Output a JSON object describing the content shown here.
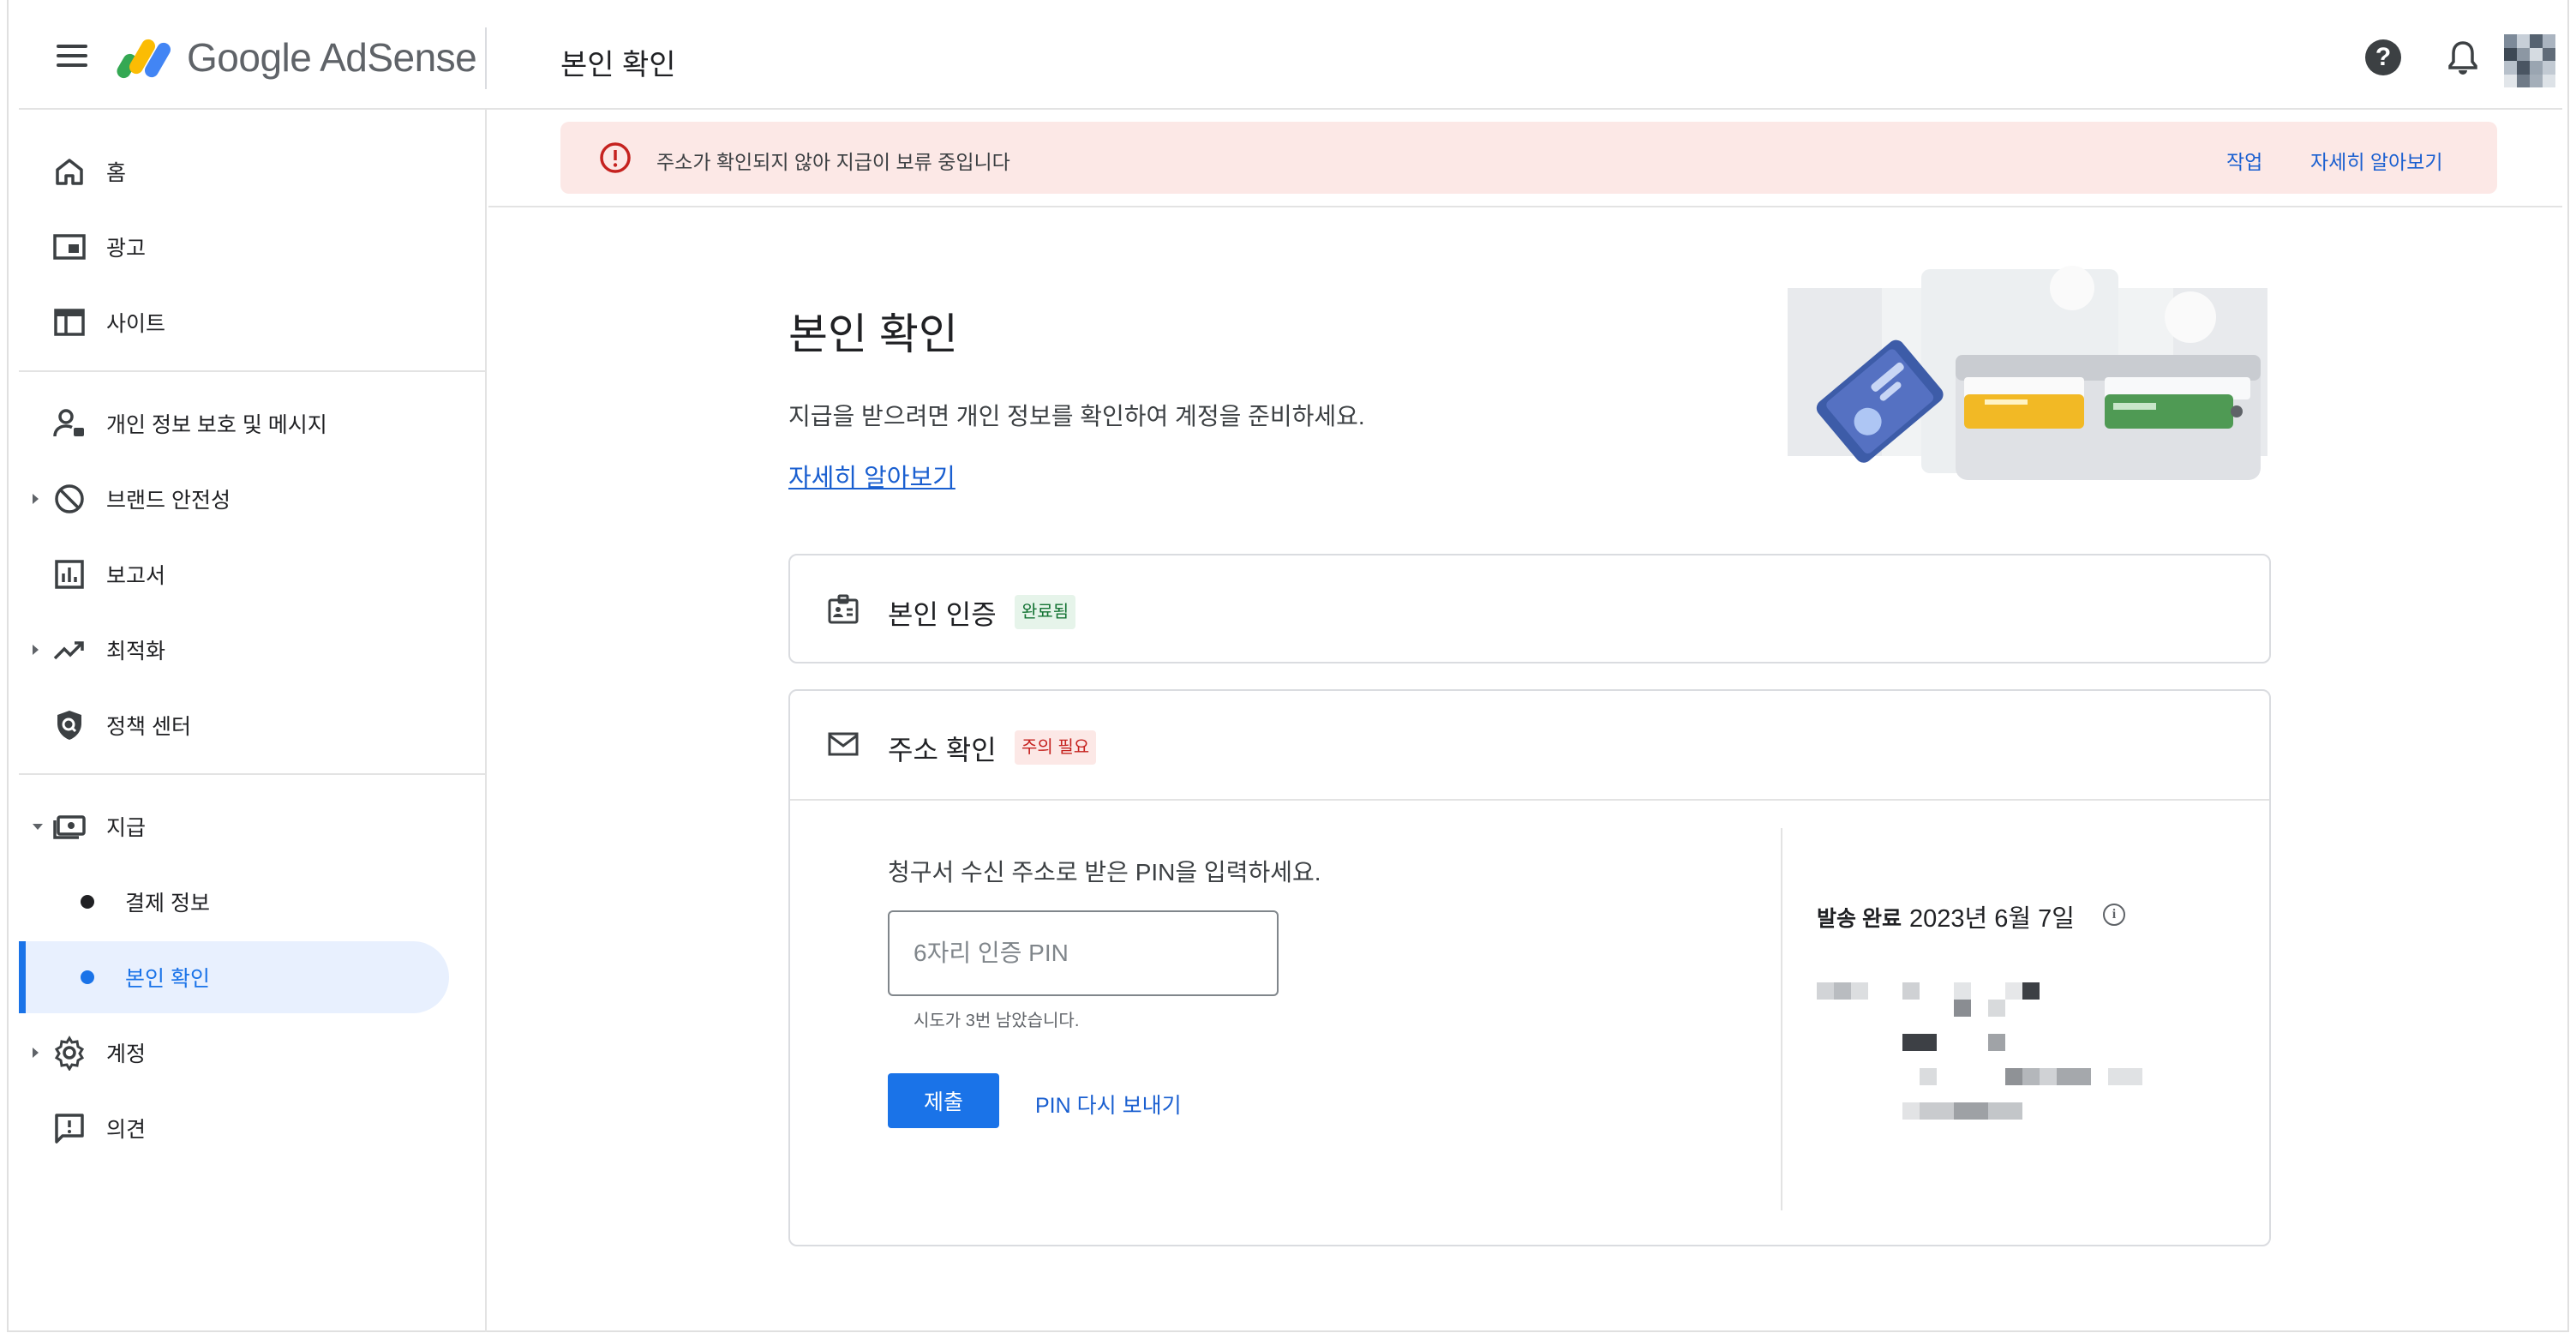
{
  "app": {
    "brand": "Google AdSense",
    "page_title": "본인 확인"
  },
  "header": {
    "help_label": "?"
  },
  "sidebar": {
    "items": [
      {
        "label": "홈",
        "icon": "home-icon"
      },
      {
        "label": "광고",
        "icon": "ads-icon"
      },
      {
        "label": "사이트",
        "icon": "sites-icon"
      },
      {
        "label": "개인 정보 보호 및 메시지",
        "icon": "privacy-messaging-icon"
      },
      {
        "label": "브랜드 안전성",
        "icon": "block-icon"
      },
      {
        "label": "보고서",
        "icon": "reports-icon"
      },
      {
        "label": "최적화",
        "icon": "trending-up-icon"
      },
      {
        "label": "정책 센터",
        "icon": "policy-shield-icon"
      },
      {
        "label": "지급",
        "icon": "payments-icon"
      },
      {
        "label": "결제 정보",
        "icon": "dot"
      },
      {
        "label": "본인 확인",
        "icon": "dot"
      },
      {
        "label": "계정",
        "icon": "gear-icon"
      },
      {
        "label": "의견",
        "icon": "feedback-icon"
      }
    ],
    "active_item": "본인 확인"
  },
  "banner": {
    "message": "주소가 확인되지 않아 지급이 보류 중입니다",
    "action_label": "작업",
    "learn_more_label": "자세히 알아보기"
  },
  "main": {
    "title": "본인 확인",
    "description": "지급을 받으려면 개인 정보를 확인하여 계정을 준비하세요.",
    "learn_more_label": "자세히 알아보기"
  },
  "identity_card": {
    "title": "본인 인증",
    "status": "완료됨"
  },
  "address_card": {
    "title": "주소 확인",
    "status": "주의 필요",
    "pin_prompt": "청구서 수신 주소로 받은 PIN을 입력하세요.",
    "pin_placeholder": "6자리 인증 PIN",
    "pin_value": "",
    "attempts_hint": "시도가 3번 남았습니다.",
    "submit_label": "제출",
    "resend_label": "PIN 다시 보내기",
    "sent_label": "발송 완료",
    "sent_date": "2023년 6월 7일"
  },
  "colors": {
    "accent": "#1a73e8",
    "banner_bg": "#fce8e6",
    "success_bg": "#e6f4ea",
    "success_text": "#137333",
    "warning_text": "#c5221f"
  }
}
